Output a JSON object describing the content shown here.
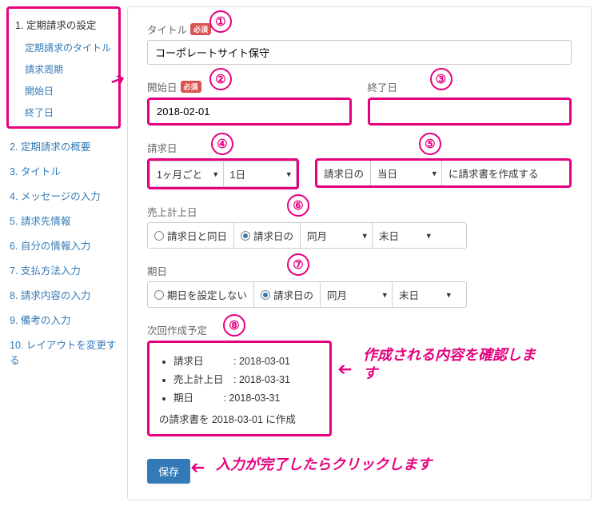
{
  "sidebar": {
    "section1": {
      "title": "1. 定期請求の設定",
      "subs": [
        "定期請求のタイトル",
        "請求周期",
        "開始日",
        "終了日"
      ]
    },
    "items": [
      "2. 定期請求の概要",
      "3. タイトル",
      "4. メッセージの入力",
      "5. 請求先情報",
      "6. 自分の情報入力",
      "7. 支払方法入力",
      "8. 請求内容の入力",
      "9. 備考の入力",
      "10. レイアウトを変更する"
    ]
  },
  "form": {
    "title_label": "タイトル",
    "required": "必須",
    "title_value": "コーポレートサイト保守",
    "start_label": "開始日",
    "start_value": "2018-02-01",
    "end_label": "終了日",
    "end_value": "",
    "billing_label": "請求日",
    "billing_cycle": "1ヶ月ごと",
    "billing_day": "1日",
    "invoice_prefix": "請求日の",
    "invoice_timing": "当日",
    "invoice_suffix": "に請求書を作成する",
    "sales_label": "売上計上日",
    "sales_opt1": "請求日と同日",
    "sales_opt2": "請求日の",
    "sales_month": "同月",
    "sales_day": "末日",
    "due_label": "期日",
    "due_opt1": "期日を設定しない",
    "due_opt2": "請求日の",
    "due_month": "同月",
    "due_day": "末日",
    "next_label": "次回作成予定",
    "next_items": [
      {
        "k": "請求日",
        "v": "2018-03-01"
      },
      {
        "k": "売上計上日",
        "v": "2018-03-31"
      },
      {
        "k": "期日",
        "v": "2018-03-31"
      }
    ],
    "next_footer": "の請求書を 2018-03-01 に作成",
    "save": "保存"
  },
  "annotations": {
    "n1": "①",
    "n2": "②",
    "n3": "③",
    "n4": "④",
    "n5": "⑤",
    "n6": "⑥",
    "n7": "⑦",
    "n8": "⑧",
    "confirm": "作成される内容を確認します",
    "click": "入力が完了したらクリックします"
  }
}
